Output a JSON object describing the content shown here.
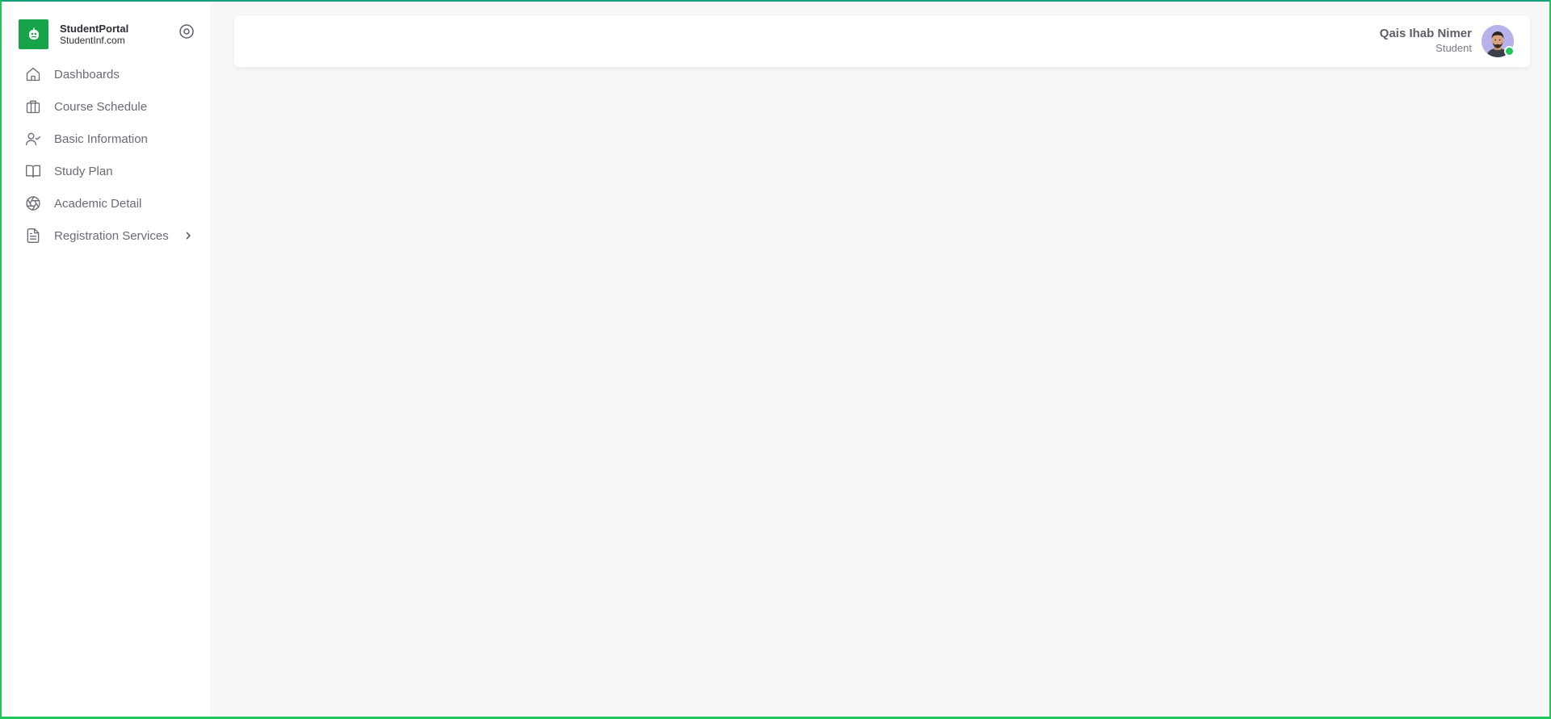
{
  "brand": {
    "name": "StudentPortal",
    "domain": "StudentInf.com",
    "color": "#16a34a"
  },
  "sidebar": {
    "items": [
      {
        "label": "Dashboards",
        "icon": "home-icon"
      },
      {
        "label": "Course Schedule",
        "icon": "briefcase-icon"
      },
      {
        "label": "Basic Information",
        "icon": "user-check-icon"
      },
      {
        "label": "Study Plan",
        "icon": "book-open-icon"
      },
      {
        "label": "Academic Detail",
        "icon": "aperture-icon"
      },
      {
        "label": "Registration Services",
        "icon": "file-text-icon",
        "has_submenu": true
      }
    ]
  },
  "header": {
    "user_name": "Qais Ihab Nimer",
    "user_role": "Student",
    "status": "online",
    "status_color": "#22c55e"
  }
}
